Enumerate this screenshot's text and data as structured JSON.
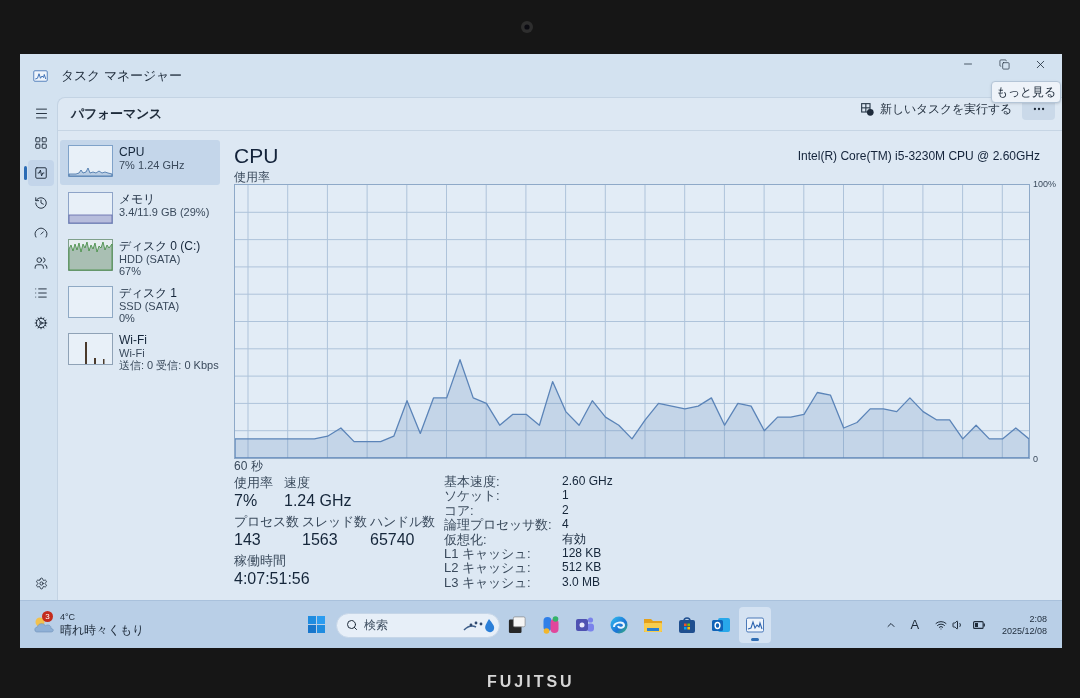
{
  "bezel": {
    "logo": "FUJITSU"
  },
  "window": {
    "title": "タスク マネージャー",
    "tooltip": "もっと見る"
  },
  "nav": [
    {
      "selected": false
    },
    {
      "selected": true
    },
    {
      "selected": false
    },
    {
      "selected": false
    },
    {
      "selected": false
    },
    {
      "selected": false
    },
    {
      "selected": false
    }
  ],
  "header": {
    "title": "パフォーマンス",
    "run_task": "新しいタスクを実行する"
  },
  "resources": [
    {
      "kind": "cpu",
      "name": "CPU",
      "lines": [
        "7% 1.24 GHz"
      ],
      "selected": true
    },
    {
      "kind": "memory",
      "name": "メモリ",
      "lines": [
        "3.4/11.9 GB (29%)"
      ],
      "selected": false
    },
    {
      "kind": "disk",
      "name": "ディスク 0 (C:)",
      "lines": [
        "HDD (SATA)",
        "67%"
      ],
      "selected": false
    },
    {
      "kind": "idle",
      "name": "ディスク 1",
      "lines": [
        "SSD (SATA)",
        "0%"
      ],
      "selected": false
    },
    {
      "kind": "network",
      "name": "Wi-Fi",
      "lines": [
        "Wi-Fi",
        "送信: 0 受信: 0 Kbps"
      ],
      "selected": false
    }
  ],
  "detail": {
    "title": "CPU",
    "model": "Intel(R) Core(TM) i5-3230M CPU @ 2.60GHz",
    "chart_data": {
      "type": "area",
      "ylim": [
        0,
        100
      ],
      "yticks": [
        {
          "value": 0,
          "label": "0"
        },
        {
          "value": 100,
          "label": "100%"
        }
      ],
      "grid": true,
      "annotations": [
        "使用率",
        "60 秒"
      ],
      "series": [
        {
          "color": "#5b84b8",
          "values": [
            7,
            7,
            7,
            7,
            7,
            7,
            7,
            8,
            11,
            6,
            6,
            6,
            8,
            21,
            9,
            22,
            22,
            36,
            22,
            20,
            12,
            16,
            16,
            12,
            28,
            17,
            12,
            21,
            15,
            12,
            7,
            14,
            20,
            19,
            18,
            19,
            22,
            12,
            20,
            19,
            10,
            15,
            15,
            16,
            24,
            23,
            11,
            13,
            18,
            18,
            17,
            22,
            17,
            14,
            14,
            7,
            12,
            7,
            7,
            11,
            7
          ]
        }
      ]
    },
    "stat_rows": [
      {
        "stats": [
          {
            "label": "使用率",
            "value": "7%"
          },
          {
            "label": "速度",
            "value": "1.24 GHz"
          }
        ]
      },
      {
        "stats": [
          {
            "label": "プロセス数",
            "value": "143"
          },
          {
            "label": "スレッド数",
            "value": "1563"
          },
          {
            "label": "ハンドル数",
            "value": "65740"
          }
        ]
      },
      {
        "stats": [
          {
            "label": "稼働時間",
            "value": "4:07:51:56"
          }
        ]
      }
    ],
    "specs": [
      {
        "label": "基本速度:",
        "value": "2.60 GHz"
      },
      {
        "label": "ソケット:",
        "value": "1"
      },
      {
        "label": "コア:",
        "value": "2"
      },
      {
        "label": "論理プロセッサ数:",
        "value": "4"
      },
      {
        "label": "仮想化:",
        "value": "有効"
      },
      {
        "label": "L1 キャッシュ:",
        "value": "128 KB"
      },
      {
        "label": "L2 キャッシュ:",
        "value": "512 KB"
      },
      {
        "label": "L3 キャッシュ:",
        "value": "3.0 MB"
      }
    ]
  },
  "taskbar": {
    "weather": {
      "badge": "3",
      "temperature": "4°C",
      "condition": "晴れ時々くもり"
    },
    "search": {
      "placeholder": "検索"
    },
    "apps": [
      {
        "active": false
      },
      {
        "active": false
      },
      {
        "active": false
      },
      {
        "active": false
      },
      {
        "active": false
      },
      {
        "active": false
      },
      {
        "active": false
      },
      {
        "active": true
      }
    ],
    "tray": {
      "input_mode": "A",
      "time": "2:08",
      "date": "2025/12/08"
    }
  }
}
